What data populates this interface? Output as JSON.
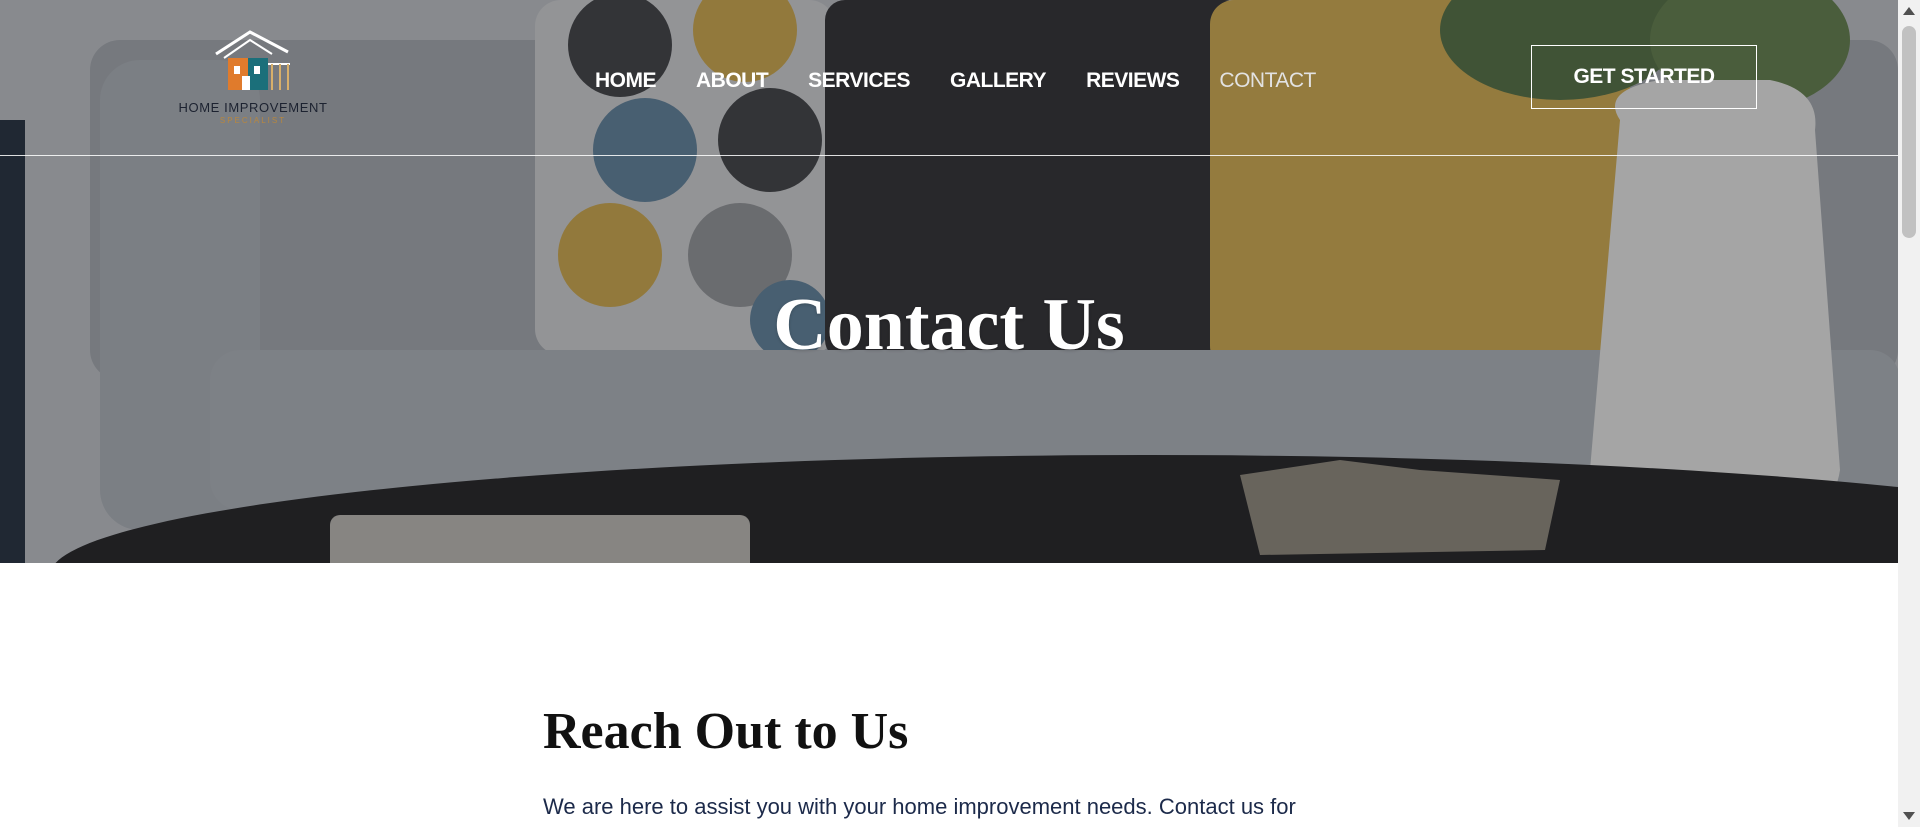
{
  "brand": {
    "name": "HOME IMPROVEMENT",
    "tagline": "SPECIALIST",
    "logo_icon": "house-icon"
  },
  "nav": {
    "items": [
      {
        "label": "HOME"
      },
      {
        "label": "ABOUT"
      },
      {
        "label": "SERVICES"
      },
      {
        "label": "GALLERY"
      },
      {
        "label": "REVIEWS"
      },
      {
        "label": "CONTACT",
        "active": true
      }
    ],
    "cta_label": "GET STARTED"
  },
  "hero": {
    "title": "Contact Us"
  },
  "content": {
    "heading": "Reach Out to Us",
    "intro": "We are here to assist you with your home improvement needs. Contact us for"
  },
  "colors": {
    "nav_text": "#ffffff",
    "heading": "#111111",
    "body_text": "#1c2a4a",
    "logo_orange": "#e07b2c",
    "logo_teal": "#1b6f7a"
  }
}
